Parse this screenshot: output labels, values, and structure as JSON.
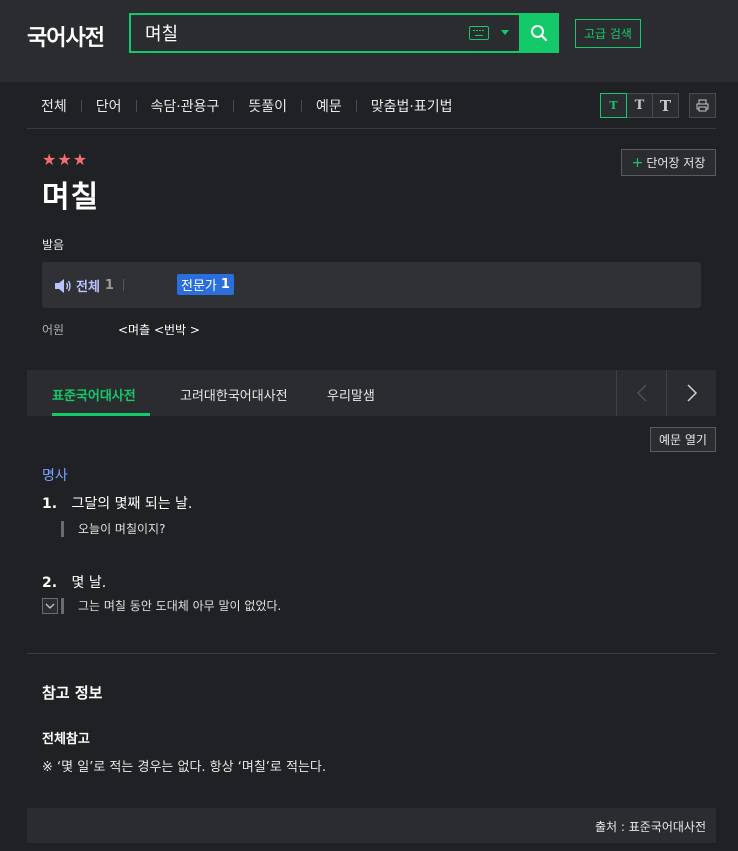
{
  "header": {
    "logo": "국어사전",
    "search_value": "며칠",
    "advanced_search": "고급 검색"
  },
  "nav": {
    "items": [
      "전체",
      "단어",
      "속담·관용구",
      "뜻풀이",
      "예문",
      "맞춤법·표기법"
    ],
    "font_sizes": [
      "T",
      "T",
      "T"
    ]
  },
  "entry": {
    "stars": "★★★",
    "word": "며칠",
    "save_button": "단어장 저장",
    "pronunciation_label": "발음",
    "pron_all_label": "전체",
    "pron_all_count": "1",
    "pron_expert_label": "전문가",
    "pron_expert_count": "1",
    "etymology_label": "어원",
    "etymology_value": "<며츨 <번박 >"
  },
  "dict_tabs": [
    "표준국어대사전",
    "고려대한국어대사전",
    "우리말샘"
  ],
  "definitions": {
    "example_open_button": "예문 열기",
    "pos": "명사",
    "senses": [
      {
        "num": "1.",
        "text": "그달의 몇째 되는 날.",
        "example": "오늘이 며칠이지?"
      },
      {
        "num": "2.",
        "text": "몇 날.",
        "example": "그는 며칠 동안 도대체 아무 말이 없었다."
      }
    ]
  },
  "reference": {
    "title": "참고 정보",
    "subtitle": "전체참고",
    "text": "※ ‘몇 일’로 적는 경우는 없다. 항상 ‘며칠’로 적는다."
  },
  "source": "출처 : 표준국어대사전",
  "colors": {
    "accent": "#14c96a",
    "background": "#202124",
    "expert_badge": "#2a6fdb",
    "stars": "#f07070",
    "pos": "#7aa2ff"
  }
}
